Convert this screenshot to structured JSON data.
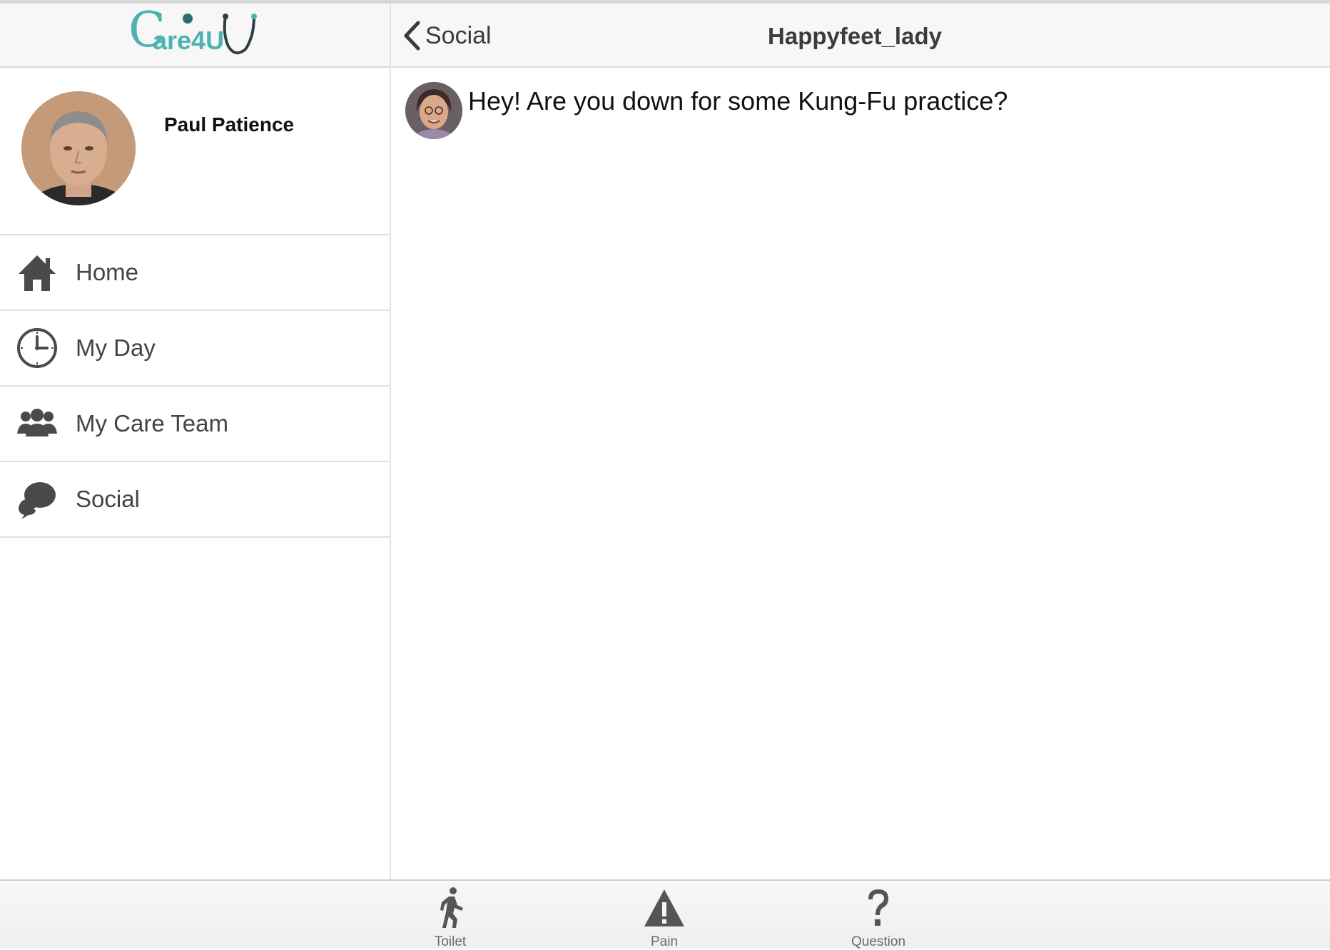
{
  "app": {
    "logo_text_c": "C",
    "logo_text_rest": "are4U"
  },
  "profile": {
    "name": "Paul Patience"
  },
  "nav": {
    "items": [
      {
        "label": "Home",
        "icon": "home-icon"
      },
      {
        "label": "My Day",
        "icon": "clock-icon"
      },
      {
        "label": "My Care Team",
        "icon": "team-icon"
      },
      {
        "label": "Social",
        "icon": "chat-bubbles-icon"
      }
    ]
  },
  "header": {
    "back_label": "Social",
    "title": "Happyfeet_lady"
  },
  "messages": [
    {
      "text": "Hey! Are you down for some Kung-Fu practice?"
    }
  ],
  "toolbar": {
    "items": [
      {
        "label": "Toilet",
        "icon": "walking-person-icon"
      },
      {
        "label": "Pain",
        "icon": "warning-icon"
      },
      {
        "label": "Question",
        "icon": "question-icon"
      }
    ]
  },
  "colors": {
    "logo_teal": "#4db3b0",
    "icon_gray": "#4a4a4a"
  }
}
